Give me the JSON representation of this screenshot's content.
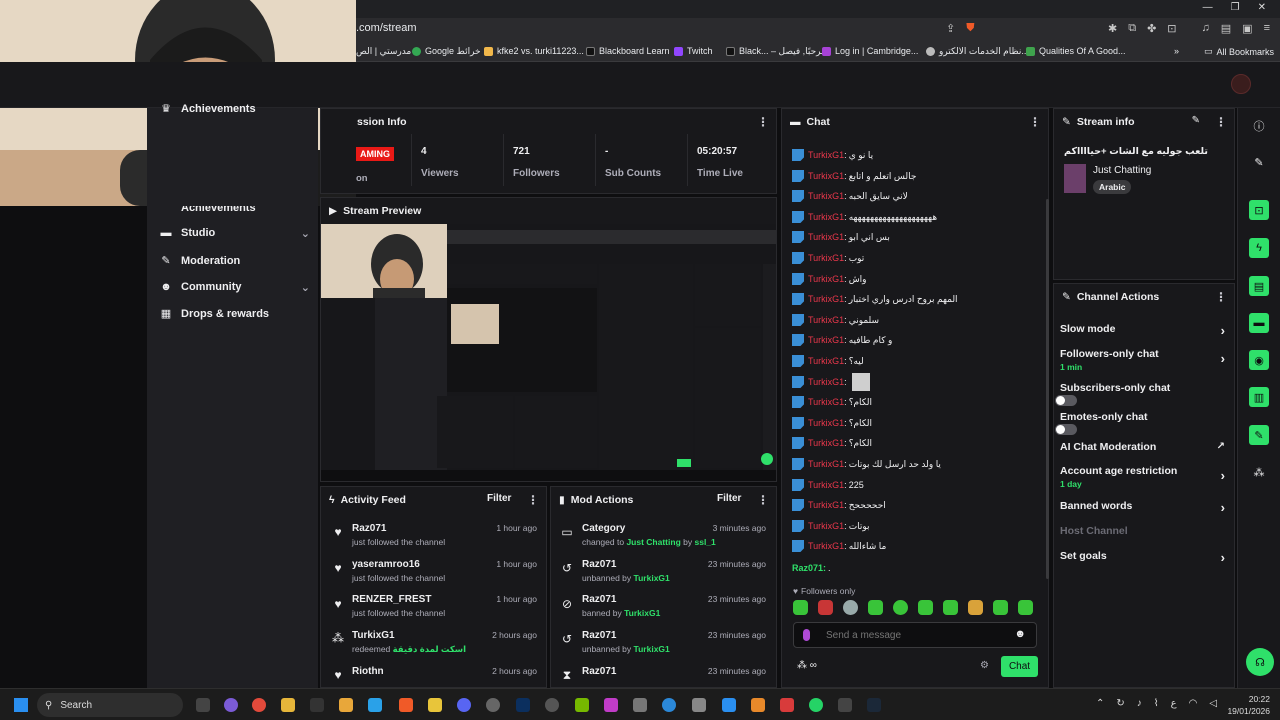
{
  "browser": {
    "url": ".com/stream",
    "bookmarks": [
      "مدرستي | الص",
      "Google خرائط",
      "kfke2 vs. turki11223...",
      "Blackboard Learn",
      "Twitch",
      "Black... – مرحبًا, فيصل",
      "Log in | Cambridge...",
      "نظام الخدمات الالكترو...",
      "Qualities Of A Good..."
    ],
    "all_bookmarks": "All Bookmarks"
  },
  "nav": {
    "items": [
      {
        "label": "Achievements",
        "icon": "trophy-icon",
        "chevron": false
      },
      {
        "label": "Studio",
        "icon": "studio-icon",
        "chevron": true
      },
      {
        "label": "Moderation",
        "icon": "wrench-icon",
        "chevron": false
      },
      {
        "label": "Community",
        "icon": "community-icon",
        "chevron": true
      },
      {
        "label": "Drops & rewards",
        "icon": "gift-icon",
        "chevron": false
      }
    ]
  },
  "session": {
    "title": "ssion Info",
    "live_label": "AMING",
    "on_label": "on",
    "stats": [
      {
        "value": "4",
        "label": "Viewers"
      },
      {
        "value": "721",
        "label": "Followers"
      },
      {
        "value": "-",
        "label": "Sub Counts"
      },
      {
        "value": "05:20:57",
        "label": "Time Live"
      }
    ]
  },
  "preview": {
    "title": "Stream Preview"
  },
  "activity": {
    "title": "Activity Feed",
    "filter": "Filter",
    "items": [
      {
        "name": "Raz071",
        "sub": "just followed the channel",
        "time": "1 hour ago",
        "icon": "heart-icon"
      },
      {
        "name": "yaseramroo16",
        "sub": "just followed the channel",
        "time": "1 hour ago",
        "icon": "heart-icon"
      },
      {
        "name": "RENZER_FREST",
        "sub": "just followed the channel",
        "time": "1 hour ago",
        "icon": "heart-icon"
      },
      {
        "name": "TurkixG1",
        "sub": "redeemed",
        "extra": "اسكت لمدة دقيقة",
        "time": "2 hours ago",
        "icon": "points-icon"
      },
      {
        "name": "Riothn",
        "sub": "",
        "time": "2 hours ago",
        "icon": "heart-icon"
      }
    ]
  },
  "mod_actions": {
    "title": "Mod Actions",
    "filter": "Filter",
    "items": [
      {
        "name": "Category",
        "sub_prefix": "changed to",
        "sub_green": "Just Chatting",
        "sub_mid": "by",
        "sub_green2": "ssl_1",
        "time": "3 minutes ago",
        "icon": "category-icon"
      },
      {
        "name": "Raz071",
        "sub_prefix": "unbanned by",
        "sub_green": "TurkixG1",
        "time": "23 minutes ago",
        "icon": "unban-icon"
      },
      {
        "name": "Raz071",
        "sub_prefix": "banned by",
        "sub_green": "TurkixG1",
        "time": "23 minutes ago",
        "icon": "ban-icon"
      },
      {
        "name": "Raz071",
        "sub_prefix": "unbanned by",
        "sub_green": "TurkixG1",
        "time": "23 minutes ago",
        "icon": "unban-icon"
      },
      {
        "name": "Raz071",
        "sub_prefix": "",
        "sub_green": "",
        "time": "23 minutes ago",
        "icon": "timeout-icon"
      }
    ]
  },
  "chat": {
    "title": "Chat",
    "messages": [
      {
        "user": "TurkixG1",
        "text": "يا نو ي"
      },
      {
        "user": "TurkixG1",
        "text": "جالس اتعلم و اتابع"
      },
      {
        "user": "TurkixG1",
        "text": "لاني سايق الحبه"
      },
      {
        "user": "TurkixG1",
        "text": "ههههههههههههههههههههه"
      },
      {
        "user": "TurkixG1",
        "text": "بس اني ابو"
      },
      {
        "user": "TurkixG1",
        "text": "توب"
      },
      {
        "user": "TurkixG1",
        "text": "واش"
      },
      {
        "user": "TurkixG1",
        "text": "المهم بروح ادرس واري اختبار"
      },
      {
        "user": "TurkixG1",
        "text": "سلموني"
      },
      {
        "user": "TurkixG1",
        "text": "و كام طافيه"
      },
      {
        "user": "TurkixG1",
        "text": "ليه؟"
      },
      {
        "user": "TurkixG1",
        "text": ""
      },
      {
        "user": "TurkixG1",
        "text": "الكام؟"
      },
      {
        "user": "TurkixG1",
        "text": "الكام؟"
      },
      {
        "user": "TurkixG1",
        "text": "الكام؟"
      },
      {
        "user": "TurkixG1",
        "text": "يا ولد حد ارسل لك بوتات"
      },
      {
        "user": "TurkixG1",
        "text": "225"
      },
      {
        "user": "TurkixG1",
        "text": "احححححح"
      },
      {
        "user": "TurkixG1",
        "text": "بوتات"
      },
      {
        "user": "TurkixG1",
        "text": "ما شاءالله"
      }
    ],
    "last_message": {
      "user": "Raz071",
      "text": "."
    },
    "followers_only": "Followers only",
    "placeholder": "Send a message",
    "send": "Chat"
  },
  "stream_info": {
    "title": "Stream info",
    "stream_title": "تلعب جوليه مع الشات +حيااااكم",
    "category": "Just Chatting",
    "tag": "Arabic"
  },
  "channel_actions": {
    "title": "Channel Actions",
    "items": [
      {
        "label": "Slow mode",
        "sub": "",
        "control": "arrow"
      },
      {
        "label": "Followers-only chat",
        "sub": "1 min",
        "control": "arrow"
      },
      {
        "label": "Subscribers-only chat",
        "sub": "",
        "control": "toggle"
      },
      {
        "label": "Emotes-only chat",
        "sub": "",
        "control": "toggle"
      },
      {
        "label": "AI Chat Moderation",
        "sub": "",
        "control": "external"
      },
      {
        "label": "Account age restriction",
        "sub": "1 day",
        "control": "arrow"
      },
      {
        "label": "Banned words",
        "sub": "",
        "control": "arrow"
      },
      {
        "label": "Host Channel",
        "sub": "",
        "control": "none"
      },
      {
        "label": "Set goals",
        "sub": "",
        "control": "arrow"
      }
    ]
  },
  "taskbar": {
    "search": "Search",
    "time": "20:22",
    "date": "19/01/2026",
    "lang": "ع"
  },
  "colors": {
    "accent_green": "#2fe06a",
    "live_red": "#e91916",
    "chat_user": "#e8374b"
  }
}
